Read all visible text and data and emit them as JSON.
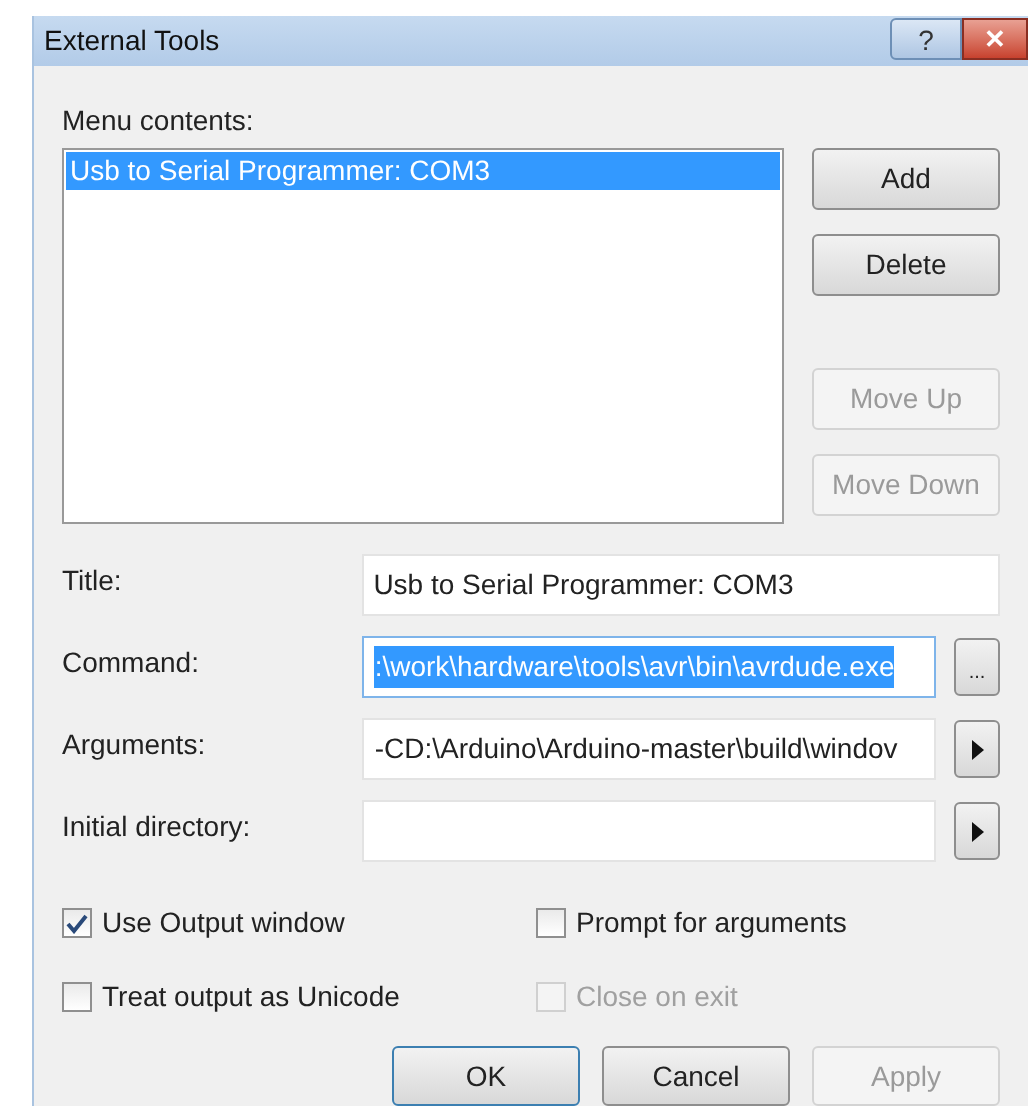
{
  "window": {
    "title": "External Tools",
    "title_buttons": [
      {
        "kind": "help",
        "label": "?"
      },
      {
        "kind": "close",
        "label": "✕"
      }
    ]
  },
  "menu_contents": {
    "label": "Menu contents:",
    "items": [
      {
        "label": "Usb to Serial Programmer: COM3",
        "selected": true
      }
    ]
  },
  "side_buttons": [
    {
      "label": "Add",
      "disabled": false
    },
    {
      "label": "Delete",
      "disabled": false
    },
    {
      "label": "Move Up",
      "disabled": true
    },
    {
      "label": "Move Down",
      "disabled": true
    }
  ],
  "fields": [
    {
      "label": "Title:",
      "value": "Usb to Serial Programmer: COM3",
      "kind": "none",
      "selected": false
    },
    {
      "label": "Command:",
      "value": ":\\work\\hardware\\tools\\avr\\bin\\avrdude.exe",
      "kind": "browse",
      "button": "...",
      "selected": true
    },
    {
      "label": "Arguments:",
      "value": "-CD:\\Arduino\\Arduino-master\\build\\windov",
      "kind": "arrow",
      "selected": false
    },
    {
      "label": "Initial directory:",
      "kind": "arrow",
      "selected": false
    }
  ],
  "options": [
    {
      "label": "Use Output window",
      "checked": true,
      "disabled": false
    },
    {
      "label": "Prompt for arguments",
      "checked": false,
      "disabled": false
    },
    {
      "label": "Treat output as Unicode",
      "checked": false,
      "disabled": false
    },
    {
      "label": "Close on exit",
      "checked": false,
      "disabled": true
    }
  ],
  "footer_buttons": [
    {
      "label": "OK",
      "disabled": false,
      "default": true
    },
    {
      "label": "Cancel",
      "disabled": false,
      "default": false
    },
    {
      "label": "Apply",
      "disabled": true,
      "default": false
    }
  ]
}
